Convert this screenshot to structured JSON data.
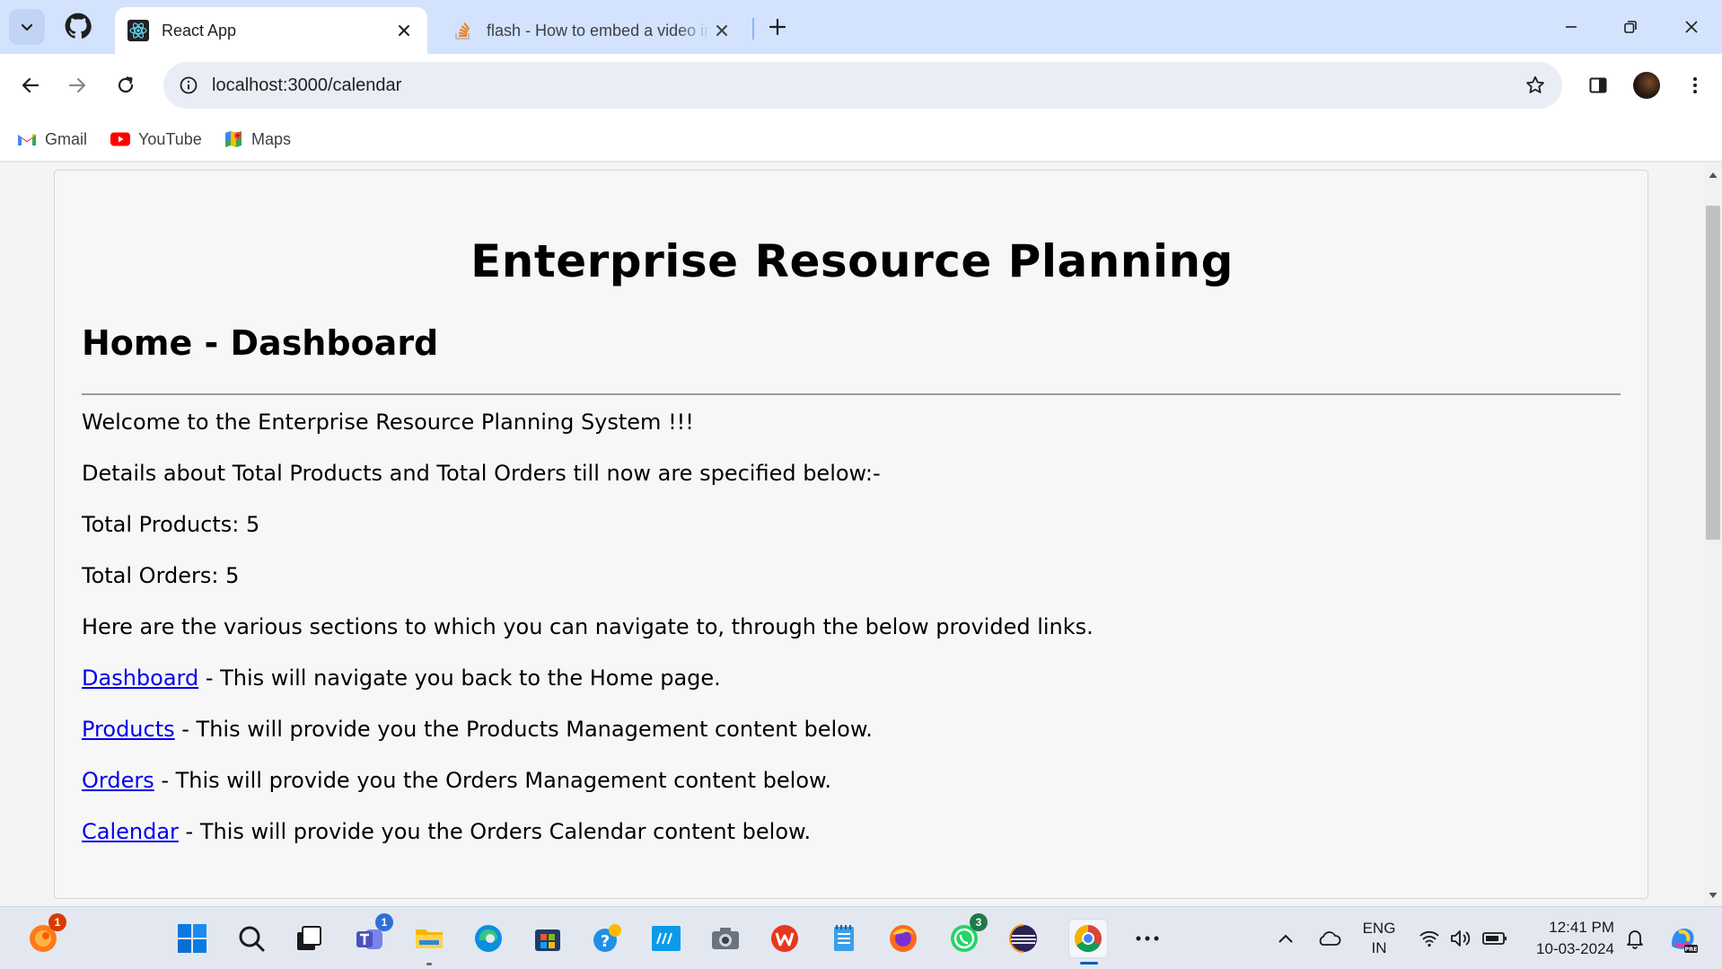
{
  "browser": {
    "tabs": [
      {
        "title": "React App",
        "active": true
      },
      {
        "title": "flash - How to embed a video in",
        "active": false
      }
    ],
    "address": "localhost:3000/calendar",
    "bookmarks": [
      {
        "label": "Gmail",
        "icon": "gmail-icon"
      },
      {
        "label": "YouTube",
        "icon": "youtube-icon"
      },
      {
        "label": "Maps",
        "icon": "maps-icon"
      }
    ]
  },
  "page": {
    "title": "Enterprise Resource Planning",
    "subtitle": "Home - Dashboard",
    "welcome": "Welcome to the Enterprise Resource Planning System !!!",
    "details": "Details about Total Products and Total Orders till now are specified below:-",
    "total_products": "Total Products: 5",
    "total_orders": "Total Orders: 5",
    "sections_intro": "Here are the various sections to which you can navigate to, through the below provided links.",
    "links": [
      {
        "label": "Dashboard",
        "desc": " - This will navigate you back to the Home page."
      },
      {
        "label": "Products",
        "desc": " - This will provide you the Products Management content below."
      },
      {
        "label": "Orders",
        "desc": " - This will provide you the Orders Management content below."
      },
      {
        "label": "Calendar",
        "desc": " - This will provide you the Orders Calendar content below."
      }
    ]
  },
  "taskbar": {
    "badges": {
      "notifications_app": "1",
      "teams": "1",
      "whatsapp": "3"
    },
    "language": {
      "line1": "ENG",
      "line2": "IN"
    },
    "clock": {
      "time": "12:41 PM",
      "date": "10-03-2024"
    }
  },
  "colors": {
    "tabstrip": "#d3e3fd",
    "link": "#0000ee",
    "taskbar": "#e3e8f0",
    "accent": "#005fb8"
  }
}
